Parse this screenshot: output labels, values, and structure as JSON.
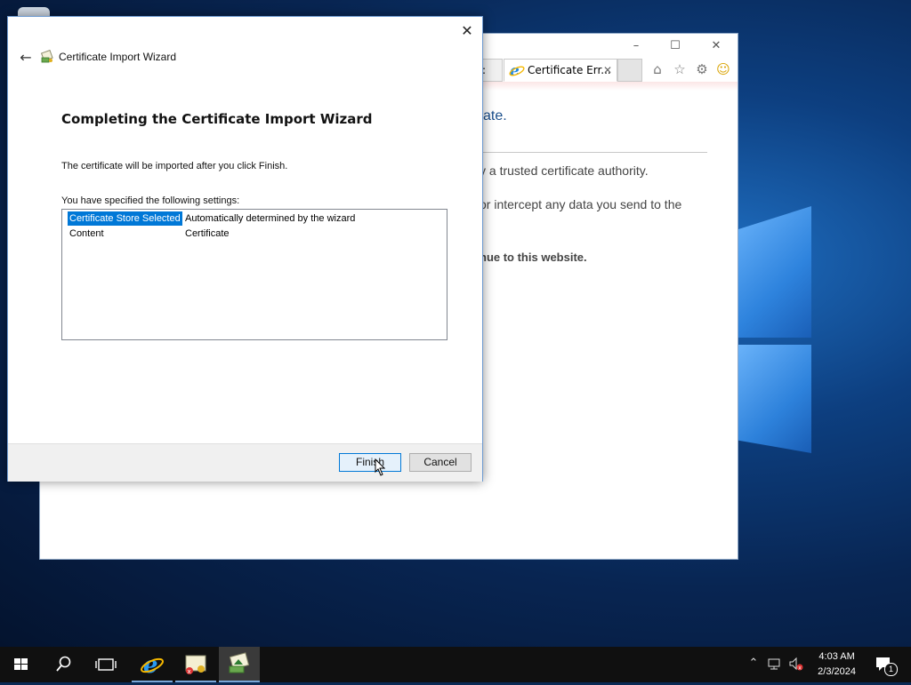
{
  "dialog": {
    "title": "Certificate Import Wizard",
    "heading": "Completing the Certificate Import Wizard",
    "info_text": "The certificate will be imported after you click Finish.",
    "settings_label": "You have specified the following settings:",
    "settings": [
      {
        "key": "Certificate Store Selected",
        "value": "Automatically determined by the wizard",
        "selected": true
      },
      {
        "key": "Content",
        "value": "Certificate",
        "selected": false
      }
    ],
    "finish_label": "Finish",
    "cancel_label": "Cancel"
  },
  "ie": {
    "tab_active": "Certificate Err...",
    "tab_prev_fragment": ":",
    "content_lines": [
      "ate.",
      "y a trusted certificate authority.",
      "or intercept any data you send to the",
      "nue to this website."
    ]
  },
  "taskbar": {
    "time": "4:03 AM",
    "date": "2/3/2024",
    "notification_count": "1"
  },
  "colors": {
    "selection": "#0078d7",
    "taskbar": "#101010",
    "desktop_blue": "#0d3f80"
  }
}
